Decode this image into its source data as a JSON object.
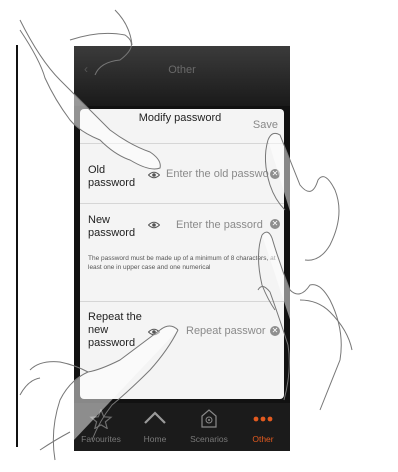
{
  "header": {
    "title": "Other"
  },
  "modal": {
    "title": "Modify password",
    "save_label": "Save",
    "old_password": {
      "label": "Old password",
      "placeholder": "Enter the old passwo"
    },
    "new_password": {
      "label": "New password",
      "placeholder": "Enter the passord"
    },
    "hint": "The password must be made up of a minimum of 8 characters, at least one in upper case and one numerical",
    "repeat_password": {
      "label": "Repeat the new password",
      "placeholder": "Repeat passwor"
    }
  },
  "tabbar": {
    "items": [
      {
        "label": "Favourites",
        "icon": "star-icon",
        "active": false
      },
      {
        "label": "Home",
        "icon": "home-icon",
        "active": false
      },
      {
        "label": "Scenarios",
        "icon": "scenarios-icon",
        "active": false
      },
      {
        "label": "Other",
        "icon": "more-dots-icon",
        "active": true
      }
    ],
    "active_color": "#e35a1f"
  }
}
